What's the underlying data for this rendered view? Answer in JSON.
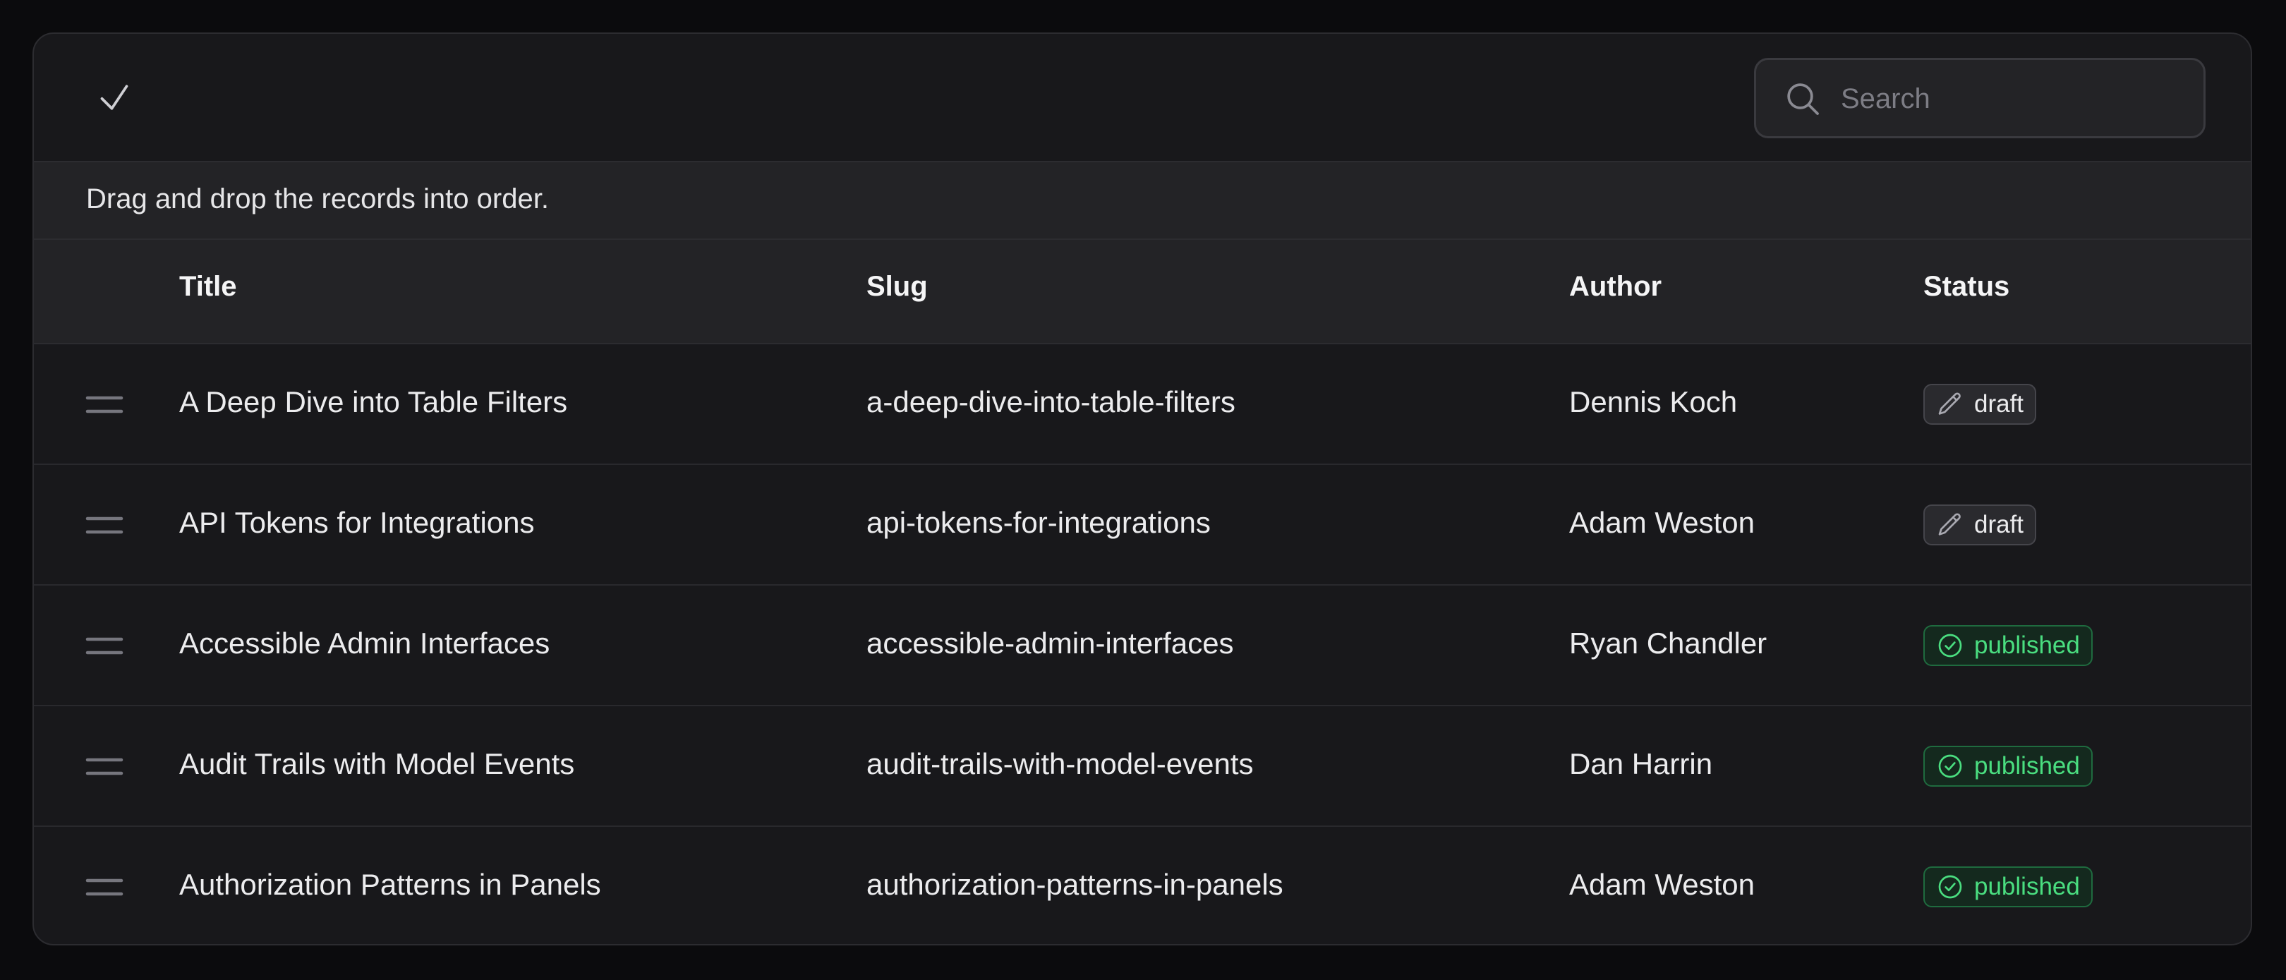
{
  "search": {
    "placeholder": "Search",
    "value": ""
  },
  "hint": "Drag and drop the records into order.",
  "columns": {
    "title": "Title",
    "slug": "Slug",
    "author": "Author",
    "status": "Status"
  },
  "rows": [
    {
      "title": "A Deep Dive into Table Filters",
      "slug": "a-deep-dive-into-table-filters",
      "author": "Dennis Koch",
      "status": "draft"
    },
    {
      "title": "API Tokens for Integrations",
      "slug": "api-tokens-for-integrations",
      "author": "Adam Weston",
      "status": "draft"
    },
    {
      "title": "Accessible Admin Interfaces",
      "slug": "accessible-admin-interfaces",
      "author": "Ryan Chandler",
      "status": "published"
    },
    {
      "title": "Audit Trails with Model Events",
      "slug": "audit-trails-with-model-events",
      "author": "Dan Harrin",
      "status": "published"
    },
    {
      "title": "Authorization Patterns in Panels",
      "slug": "authorization-patterns-in-panels",
      "author": "Adam Weston",
      "status": "published"
    }
  ],
  "status_icons": {
    "draft": "pencil-icon",
    "published": "check-circle-icon"
  },
  "colors": {
    "published_text": "#4ade80",
    "published_bg": "#14291e",
    "draft_bg": "#2a2a2e"
  }
}
